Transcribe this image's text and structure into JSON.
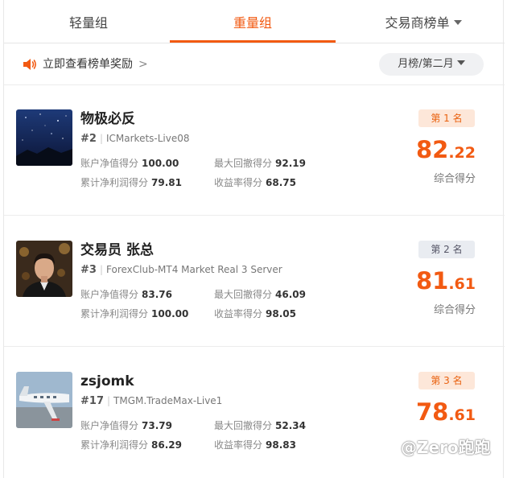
{
  "tabs": [
    {
      "label": "轻量组",
      "active": false
    },
    {
      "label": "重量组",
      "active": true
    },
    {
      "label": "交易商榜单",
      "active": false
    }
  ],
  "notice": {
    "text": "立即查看榜单奖励",
    "arrow": ">",
    "icon": "speaker-icon"
  },
  "period": {
    "label": "月榜/第二月"
  },
  "colors": {
    "accent": "#f25a12",
    "gold_badge_bg": "#fde7d9",
    "silver_badge_bg": "#e9ecf1"
  },
  "entries": [
    {
      "name": "物极必反",
      "rank_no": "#2",
      "server": "ICMarkets-Live08",
      "badge": "第 1 名",
      "score_int": "82",
      "score_dec": ".22",
      "score_label": "综合得分",
      "stats": [
        {
          "label": "账户净值得分",
          "value": "100.00"
        },
        {
          "label": "最大回撤得分",
          "value": "92.19"
        },
        {
          "label": "累计净利润得分",
          "value": "79.81"
        },
        {
          "label": "收益率得分",
          "value": "68.75"
        }
      ]
    },
    {
      "name": "交易员 张总",
      "rank_no": "#3",
      "server": "ForexClub-MT4 Market Real 3 Server",
      "badge": "第 2 名",
      "score_int": "81",
      "score_dec": ".61",
      "score_label": "综合得分",
      "stats": [
        {
          "label": "账户净值得分",
          "value": "83.76"
        },
        {
          "label": "最大回撤得分",
          "value": "46.09"
        },
        {
          "label": "累计净利润得分",
          "value": "100.00"
        },
        {
          "label": "收益率得分",
          "value": "98.05"
        }
      ]
    },
    {
      "name": "zsjomk",
      "rank_no": "#17",
      "server": "TMGM.TradeMax-Live1",
      "badge": "第 3 名",
      "score_int": "78",
      "score_dec": ".61",
      "score_label": "",
      "stats": [
        {
          "label": "账户净值得分",
          "value": "73.79"
        },
        {
          "label": "最大回撤得分",
          "value": "52.34"
        },
        {
          "label": "累计净利润得分",
          "value": "86.29"
        },
        {
          "label": "收益率得分",
          "value": "98.83"
        }
      ]
    }
  ],
  "watermark": "@Zero跑跑"
}
